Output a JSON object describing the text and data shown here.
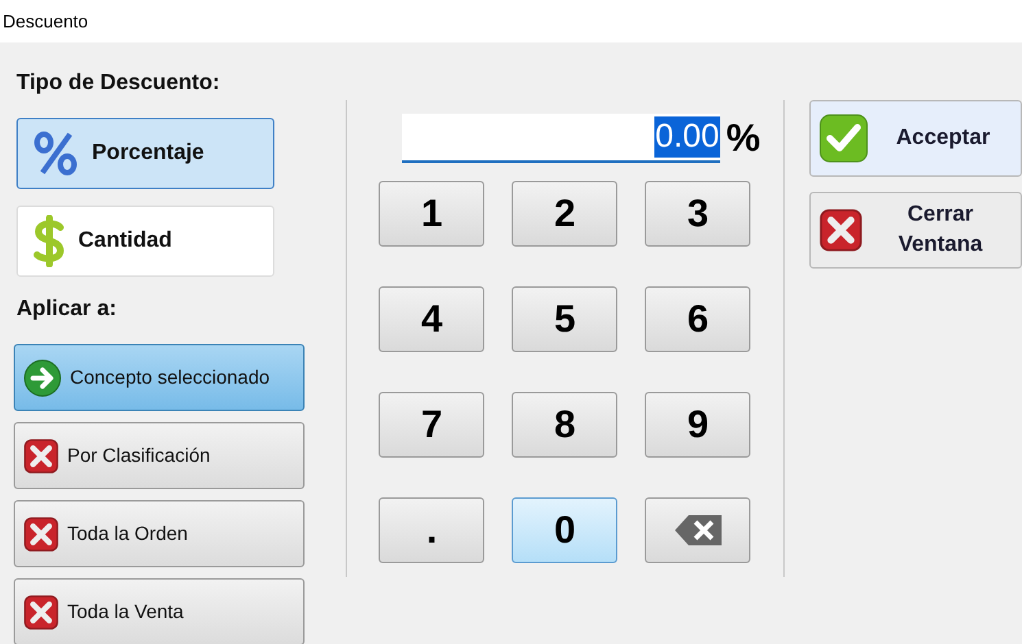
{
  "window": {
    "title": "Descuento"
  },
  "discount_type": {
    "label": "Tipo de Descuento:",
    "options": [
      {
        "label": "Porcentaje",
        "kind": "percent",
        "selected": true
      },
      {
        "label": "Cantidad",
        "kind": "amount",
        "selected": false
      }
    ]
  },
  "apply_to": {
    "label": "Aplicar a:",
    "options": [
      {
        "label": "Concepto seleccionado",
        "selected": true
      },
      {
        "label": "Por Clasificación",
        "selected": false
      },
      {
        "label": "Toda la Orden",
        "selected": false
      },
      {
        "label": "Toda la Venta",
        "selected": false
      }
    ]
  },
  "amount": {
    "value": "0.00",
    "unit": "%"
  },
  "keypad": [
    {
      "label": "1",
      "kind": "digit",
      "hovered": false
    },
    {
      "label": "2",
      "kind": "digit",
      "hovered": false
    },
    {
      "label": "3",
      "kind": "digit",
      "hovered": false
    },
    {
      "label": "4",
      "kind": "digit",
      "hovered": false
    },
    {
      "label": "5",
      "kind": "digit",
      "hovered": false
    },
    {
      "label": "6",
      "kind": "digit",
      "hovered": false
    },
    {
      "label": "7",
      "kind": "digit",
      "hovered": false
    },
    {
      "label": "8",
      "kind": "digit",
      "hovered": false
    },
    {
      "label": "9",
      "kind": "digit",
      "hovered": false
    },
    {
      "label": ".",
      "kind": "digit",
      "hovered": false
    },
    {
      "label": "0",
      "kind": "digit",
      "hovered": true
    },
    {
      "kind": "backspace",
      "hovered": false
    }
  ],
  "actions": [
    {
      "label": "Acceptar",
      "kind": "accept"
    },
    {
      "label": "Cerrar Ventana",
      "kind": "close"
    }
  ]
}
